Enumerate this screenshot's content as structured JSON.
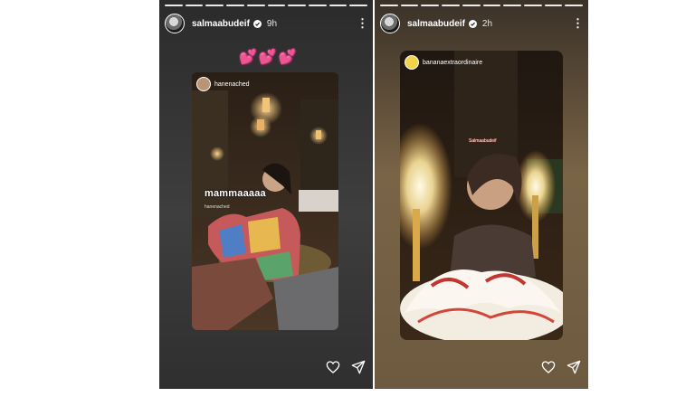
{
  "stories": [
    {
      "username": "salmaabudeif",
      "time": "9h",
      "hearts": [
        "💕",
        "💕",
        "💕"
      ],
      "mention": "hanenached",
      "caption": "mammaaaaa",
      "caption_small": "hanenached"
    },
    {
      "username": "salmaabudeif",
      "time": "2h",
      "mention": "bananaextraordinaire",
      "tag": "Salmaabudeif"
    }
  ],
  "icons": {
    "verified": "verified-badge-icon",
    "more": "more-options-icon",
    "like": "heart-icon",
    "share": "send-icon"
  },
  "colors": {
    "heart": "#ff5fb7",
    "verified": "#3897f0"
  }
}
